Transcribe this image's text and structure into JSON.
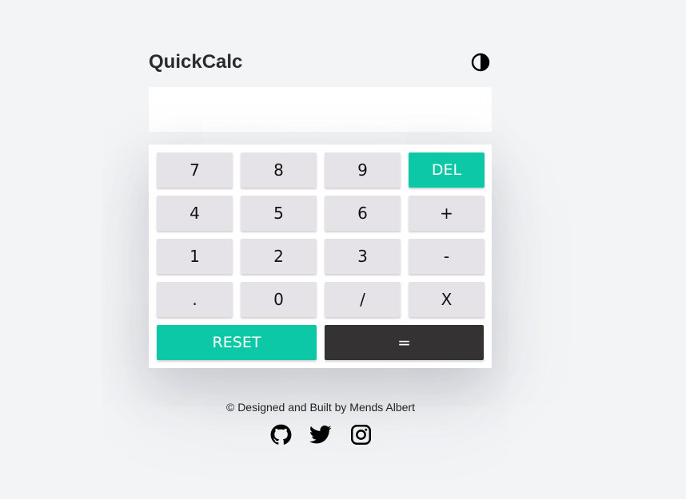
{
  "app": {
    "title": "QuickCalc",
    "theme_toggle_icon": "contrast-icon"
  },
  "display": {
    "value": ""
  },
  "keypad": {
    "keys": [
      {
        "label": "7"
      },
      {
        "label": "8"
      },
      {
        "label": "9"
      },
      {
        "label": "DEL"
      },
      {
        "label": "4"
      },
      {
        "label": "5"
      },
      {
        "label": "6"
      },
      {
        "label": "+"
      },
      {
        "label": "1"
      },
      {
        "label": "2"
      },
      {
        "label": "3"
      },
      {
        "label": "-"
      },
      {
        "label": "."
      },
      {
        "label": "0"
      },
      {
        "label": "/"
      },
      {
        "label": "X"
      }
    ],
    "reset_label": "RESET",
    "equals_label": "="
  },
  "footer": {
    "credit": "© Designed and Built by Mends Albert",
    "social_icons": [
      "github-icon",
      "twitter-icon",
      "instagram-icon"
    ]
  },
  "colors": {
    "background": "#f3f4f6",
    "accent": "#0cc8a6",
    "key": "#e5e3e8",
    "equals": "#343233",
    "text": "#2b2b2b"
  }
}
